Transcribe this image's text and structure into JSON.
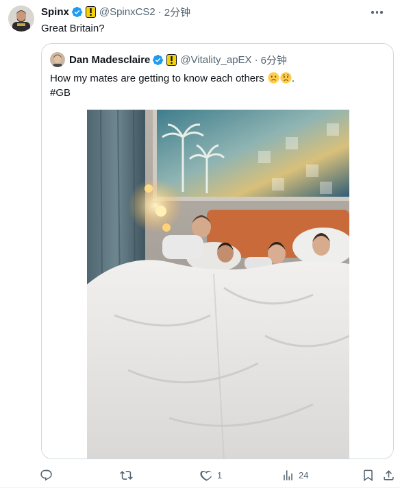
{
  "tweet": {
    "author_name": "Spinx",
    "author_handle": "@SpinxCS2",
    "time": "2分钟",
    "text": "Great Britain?"
  },
  "quote": {
    "author_name": "Dan Madesclaire",
    "author_handle": "@Vitality_apEX",
    "time": "6分钟",
    "text": "How my mates are getting to know each others",
    "text_end": ".",
    "hashtag": "#GB"
  },
  "actions": {
    "reply_count": "",
    "retweet_count": "",
    "like_count": "1",
    "views_count": "24"
  },
  "colors": {
    "verified_blue": "#1d9bf0",
    "affiliate_yellow": "#f5d10a",
    "secondary_text": "#536471",
    "border": "#cfd9de"
  },
  "icons": [
    "verified-badge-icon",
    "affiliate-badge-icon",
    "more-icon",
    "reply-icon",
    "retweet-icon",
    "like-icon",
    "views-icon",
    "bookmark-icon",
    "share-icon",
    "slightly-frowning-face-emoji",
    "worried-face-emoji"
  ]
}
